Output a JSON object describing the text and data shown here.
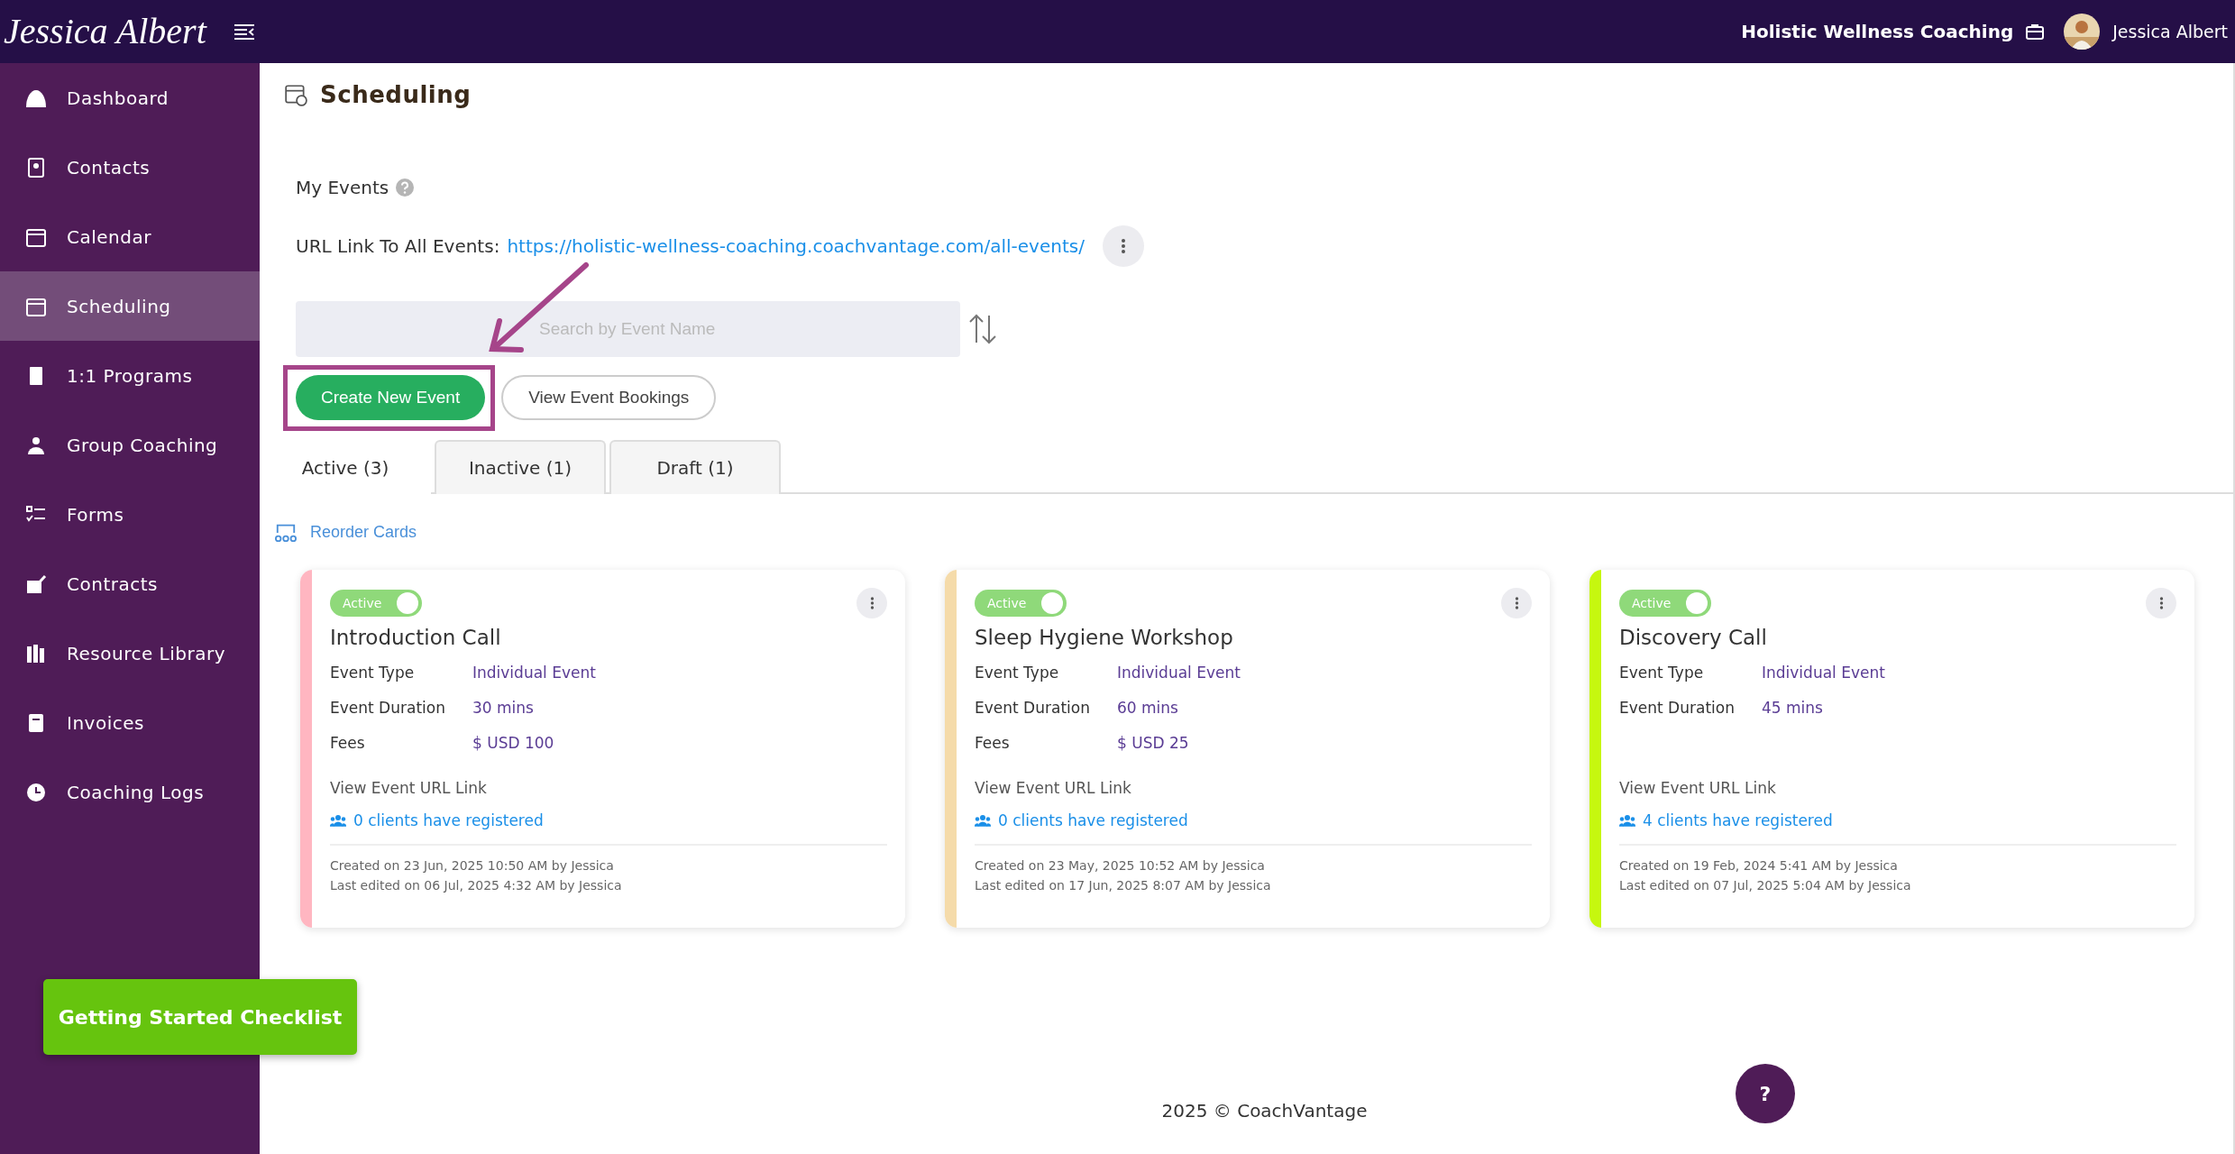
{
  "header": {
    "logo": "Jessica Albert",
    "business": "Holistic Wellness Coaching",
    "user": "Jessica Albert"
  },
  "sidebar": {
    "items": [
      {
        "label": "Dashboard",
        "selected": false
      },
      {
        "label": "Contacts",
        "selected": false
      },
      {
        "label": "Calendar",
        "selected": false
      },
      {
        "label": "Scheduling",
        "selected": true
      },
      {
        "label": "1:1 Programs",
        "selected": false
      },
      {
        "label": "Group Coaching",
        "selected": false
      },
      {
        "label": "Forms",
        "selected": false
      },
      {
        "label": "Contracts",
        "selected": false
      },
      {
        "label": "Resource Library",
        "selected": false
      },
      {
        "label": "Invoices",
        "selected": false
      },
      {
        "label": "Coaching Logs",
        "selected": false
      }
    ],
    "checklist_button": "Getting Started Checklist"
  },
  "page": {
    "title": "Scheduling",
    "section": "My Events",
    "url_label": "URL Link To All Events:",
    "url": "https://holistic-wellness-coaching.coachvantage.com/all-events/",
    "search": {
      "placeholder": "Search by Event Name"
    },
    "buttons": [
      "Create New Event",
      "View Event Bookings"
    ],
    "tabs": [
      {
        "label": "Active (3)",
        "selected": true
      },
      {
        "label": "Inactive (1)",
        "selected": false
      },
      {
        "label": "Draft (1)",
        "selected": false
      }
    ],
    "reorder": "Reorder Cards",
    "cards": [
      {
        "color": "#ffb6c1",
        "status": "Active",
        "on": true,
        "title": "Introduction Call",
        "details": [
          {
            "label": "Event Type",
            "value": "Individual Event"
          },
          {
            "label": "Event Duration",
            "value": "30 mins"
          },
          {
            "label": "Fees",
            "value": "$ USD 100"
          }
        ],
        "url_link": "View Event URL Link",
        "registered": "0 clients have registered",
        "created": "Created on 23 Jun, 2025 10:50 AM by Jessica",
        "edited": "Last edited on 06 Jul, 2025 4:32 AM by Jessica"
      },
      {
        "color": "#f5dbaa",
        "status": "Active",
        "on": true,
        "title": "Sleep Hygiene Workshop",
        "details": [
          {
            "label": "Event Type",
            "value": "Individual Event"
          },
          {
            "label": "Event Duration",
            "value": "60 mins"
          },
          {
            "label": "Fees",
            "value": "$ USD 25"
          }
        ],
        "url_link": "View Event URL Link",
        "registered": "0 clients have registered",
        "created": "Created on 23 May, 2025 10:52 AM by Jessica",
        "edited": "Last edited on 17 Jun, 2025 8:07 AM by Jessica"
      },
      {
        "color": "#c6f70f",
        "status": "Active",
        "on": true,
        "title": "Discovery Call",
        "details": [
          {
            "label": "Event Type",
            "value": "Individual Event"
          },
          {
            "label": "Event Duration",
            "value": "45 mins"
          }
        ],
        "url_link": "View Event URL Link",
        "registered": "4 clients have registered",
        "created": "Created on 19 Feb, 2024 5:41 AM by Jessica",
        "edited": "Last edited on 07 Jul, 2025 5:04 AM by Jessica"
      }
    ],
    "help_button": "?"
  },
  "footer": "2025 © CoachVantage"
}
